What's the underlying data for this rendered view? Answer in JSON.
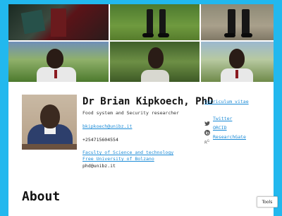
{
  "profile": {
    "name": "Dr Brian Kipkoech, PhD",
    "subtitle": "Food system and Security researcher",
    "email": "bkipkoech@unibz.it",
    "phone": "+254715604554",
    "affiliation_line1": "Faculty of Science and technology",
    "affiliation_line2": "Free University of Bolzano",
    "phd_email": "phd@unibz.it"
  },
  "sidebar": {
    "cv_label": "Curriculum vitae",
    "links": [
      {
        "label": "Twitter",
        "icon": "twitter-icon"
      },
      {
        "label": "ORCID",
        "icon": "orcid-icon"
      },
      {
        "label": "ResearchGate",
        "icon": "researchgate-icon"
      }
    ]
  },
  "section": {
    "about_heading": "About"
  },
  "tools": {
    "label": "Tools"
  },
  "colors": {
    "background": "#22b8ee",
    "link": "#1a8ad6",
    "text": "#111111"
  }
}
